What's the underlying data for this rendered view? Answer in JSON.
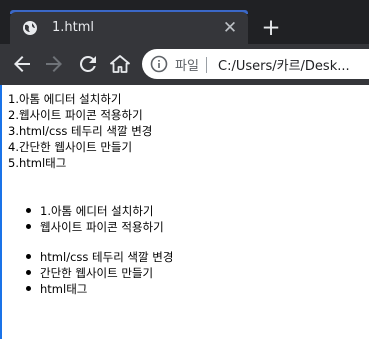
{
  "tab": {
    "title": "1.html",
    "close_glyph": "✕",
    "icon": "globe-icon"
  },
  "new_tab_glyph": "+",
  "toolbar": {
    "back_icon": "back-arrow-icon",
    "forward_icon": "forward-arrow-icon",
    "reload_icon": "reload-icon",
    "home_icon": "home-icon"
  },
  "address": {
    "scheme_label": "파일",
    "url": "C:/Users/카르/Desk..."
  },
  "page": {
    "lines": [
      "1.아톰 에디터 설치하기",
      "2.웹사이트 파이콘 적용하기",
      "3.html/css 테두리 색깔 변경",
      "4.간단한 웹사이트 만들기",
      "5.html태그"
    ],
    "list1": [
      "1.아톰 에디터 설치하기",
      "웹사이트 파이콘 적용하기"
    ],
    "list2": [
      "html/css 테두리 색깔 변경",
      "간단한 웹사이트 만들기",
      "html태그"
    ]
  },
  "colors": {
    "tab_accent": "#3b68c7",
    "chrome_dark": "#202124",
    "toolbar": "#35363a"
  }
}
